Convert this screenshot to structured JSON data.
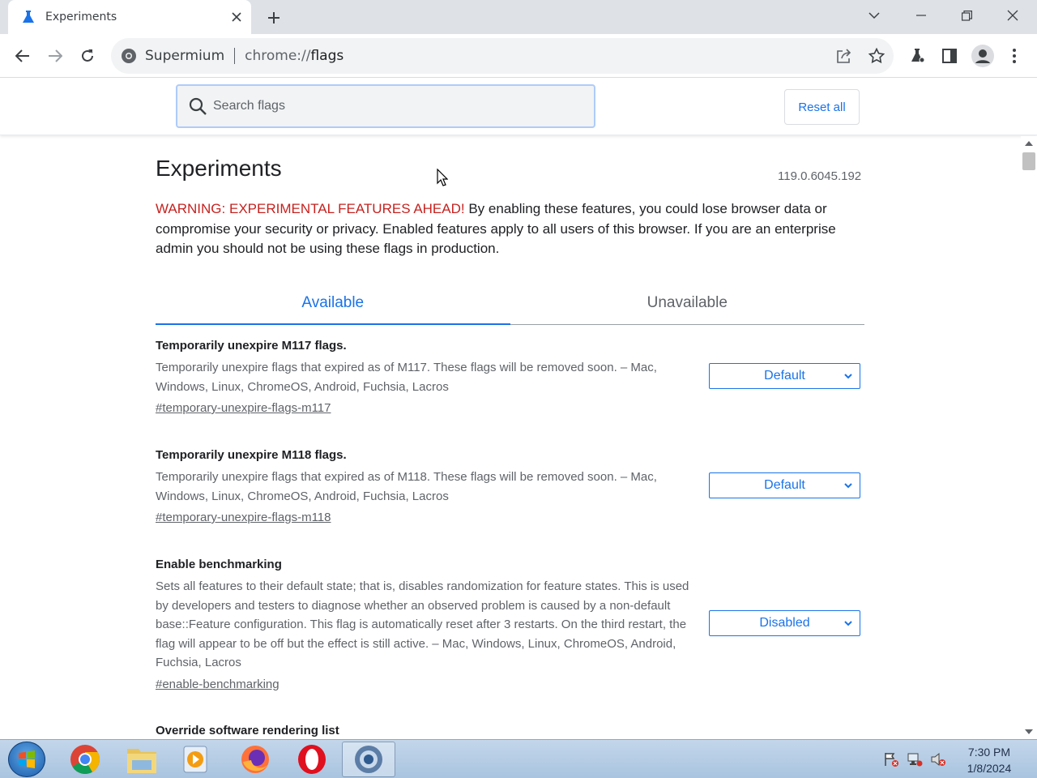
{
  "browser": {
    "tab_title": "Experiments",
    "omnibox_site": "Supermium",
    "url_scheme": "chrome://",
    "url_path": "flags"
  },
  "flags_header": {
    "search_placeholder": "Search flags",
    "reset_label": "Reset all"
  },
  "page": {
    "title": "Experiments",
    "version": "119.0.6045.192",
    "warning_prefix": "WARNING: EXPERIMENTAL FEATURES AHEAD!",
    "warning_text": " By enabling these features, you could lose browser data or compromise your security or privacy. Enabled features apply to all users of this browser. If you are an enterprise admin you should not be using these flags in production."
  },
  "tabs": {
    "available": "Available",
    "unavailable": "Unavailable"
  },
  "flags": [
    {
      "name": "Temporarily unexpire M117 flags.",
      "description": "Temporarily unexpire flags that expired as of M117. These flags will be removed soon. – Mac, Windows, Linux, ChromeOS, Android, Fuchsia, Lacros",
      "link": "#temporary-unexpire-flags-m117",
      "value": "Default"
    },
    {
      "name": "Temporarily unexpire M118 flags.",
      "description": "Temporarily unexpire flags that expired as of M118. These flags will be removed soon. – Mac, Windows, Linux, ChromeOS, Android, Fuchsia, Lacros",
      "link": "#temporary-unexpire-flags-m118",
      "value": "Default"
    },
    {
      "name": "Enable benchmarking",
      "description": "Sets all features to their default state; that is, disables randomization for feature states. This is used by developers and testers to diagnose whether an observed problem is caused by a non-default base::Feature configuration. This flag is automatically reset after 3 restarts. On the third restart, the flag will appear to be off but the effect is still active. – Mac, Windows, Linux, ChromeOS, Android, Fuchsia, Lacros",
      "link": "#enable-benchmarking",
      "value": "Disabled"
    },
    {
      "name": "Override software rendering list"
    }
  ],
  "taskbar": {
    "time": "7:30 PM",
    "date": "1/8/2024"
  },
  "colors": {
    "accent": "#1a73e8",
    "warning": "#c5221f"
  }
}
